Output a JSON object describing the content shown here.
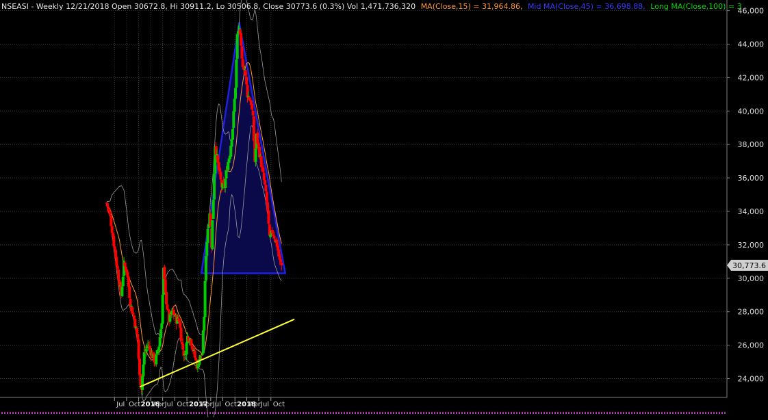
{
  "header": {
    "symbol_line": "NSEASI - Weekly 12/21/2018 Open 30672.8, Hi 30911.2, Lo 30506.8, Close 30773.6 (0.3%) Vol 1,471,736,320",
    "ma15": "MA(Close,15) = 31,964.86,",
    "mid_ma": "Mid MA(Close,45) = 36,698.88,",
    "long_ma": "Long MA(Close,100) = 3"
  },
  "colors": {
    "background": "#000000",
    "grid": "#404040",
    "up": "#00cc00",
    "down": "#ff0000",
    "ma15": "#ff9933",
    "bollinger": "#9a9a9a",
    "triangle_fill": "#0a0a4a",
    "triangle_stroke": "#2020e0",
    "trendline": "#ffff33",
    "header_default": "#e8e8e8",
    "header_ma15": "#ff9933",
    "header_mid": "#3a3aff",
    "header_long": "#00dd00",
    "price_tag": "#d0d0d0"
  },
  "chart_data": {
    "type": "candlestick",
    "title": "NSEASI - Weekly",
    "ylim": [
      23000,
      46500
    ],
    "yticks": [
      24000,
      26000,
      28000,
      30000,
      32000,
      34000,
      36000,
      38000,
      40000,
      42000,
      44000,
      46000
    ],
    "ytick_labels": [
      "24,000",
      "26,000",
      "28,000",
      "30,000",
      "32,000",
      "34,000",
      "36,000",
      "38,000",
      "40,000",
      "42,000",
      "44,000",
      "46,000"
    ],
    "xticks": [
      {
        "date": "2015-07-01",
        "label": "Jul",
        "major": false
      },
      {
        "date": "2015-10-01",
        "label": "Oct",
        "major": false
      },
      {
        "date": "2016-01-01",
        "label": "2016",
        "major": true
      },
      {
        "date": "2016-04-01",
        "label": "Apr",
        "major": false
      },
      {
        "date": "2016-07-01",
        "label": "Jul",
        "major": false
      },
      {
        "date": "2016-10-01",
        "label": "Oct",
        "major": false
      },
      {
        "date": "2017-01-01",
        "label": "2017",
        "major": true
      },
      {
        "date": "2017-04-01",
        "label": "Apr",
        "major": false
      },
      {
        "date": "2017-07-01",
        "label": "Jul",
        "major": false
      },
      {
        "date": "2017-10-01",
        "label": "Oct",
        "major": false
      },
      {
        "date": "2018-01-01",
        "label": "2018",
        "major": true
      },
      {
        "date": "2018-04-01",
        "label": "Apr",
        "major": false
      },
      {
        "date": "2018-07-01",
        "label": "Jul",
        "major": false
      },
      {
        "date": "2018-10-01",
        "label": "Oct",
        "major": false
      }
    ],
    "last_close": 30773.6,
    "last_close_label": "30,773.6",
    "last_date": "2018-12-21",
    "price_path": [
      [
        "2015-05-01",
        34500
      ],
      [
        "2015-05-29",
        33700
      ],
      [
        "2015-06-26",
        32100
      ],
      [
        "2015-07-24",
        30500
      ],
      [
        "2015-08-21",
        29000
      ],
      [
        "2015-09-11",
        30800
      ],
      [
        "2015-10-02",
        30500
      ],
      [
        "2015-10-30",
        28500
      ],
      [
        "2015-11-27",
        27600
      ],
      [
        "2015-12-25",
        26300
      ],
      [
        "2016-01-08",
        24100
      ],
      [
        "2016-01-22",
        23500
      ],
      [
        "2016-02-12",
        25500
      ],
      [
        "2016-03-11",
        26000
      ],
      [
        "2016-04-08",
        25500
      ],
      [
        "2016-05-06",
        25000
      ],
      [
        "2016-06-03",
        26000
      ],
      [
        "2016-06-24",
        27500
      ],
      [
        "2016-07-08",
        30500
      ],
      [
        "2016-07-22",
        29000
      ],
      [
        "2016-08-19",
        27500
      ],
      [
        "2016-09-16",
        28000
      ],
      [
        "2016-10-14",
        27500
      ],
      [
        "2016-11-04",
        27500
      ],
      [
        "2016-11-25",
        26000
      ],
      [
        "2016-12-16",
        25300
      ],
      [
        "2017-01-06",
        26500
      ],
      [
        "2017-01-27",
        26400
      ],
      [
        "2017-02-24",
        25500
      ],
      [
        "2017-03-17",
        24800
      ],
      [
        "2017-04-07",
        25200
      ],
      [
        "2017-04-28",
        25500
      ],
      [
        "2017-05-12",
        27800
      ],
      [
        "2017-05-26",
        31500
      ],
      [
        "2017-06-09",
        33000
      ],
      [
        "2017-06-23",
        34000
      ],
      [
        "2017-07-07",
        32000
      ],
      [
        "2017-07-21",
        34800
      ],
      [
        "2017-08-04",
        38000
      ],
      [
        "2017-08-25",
        36800
      ],
      [
        "2017-09-22",
        35500
      ],
      [
        "2017-10-13",
        35500
      ],
      [
        "2017-11-03",
        36700
      ],
      [
        "2017-11-24",
        37500
      ],
      [
        "2017-12-15",
        39000
      ],
      [
        "2018-01-05",
        41500
      ],
      [
        "2018-01-19",
        44500
      ],
      [
        "2018-02-02",
        45000
      ],
      [
        "2018-02-23",
        43000
      ],
      [
        "2018-03-16",
        42500
      ],
      [
        "2018-04-06",
        41000
      ],
      [
        "2018-05-04",
        40500
      ],
      [
        "2018-05-18",
        39500
      ],
      [
        "2018-06-01",
        37000
      ],
      [
        "2018-06-15",
        38500
      ],
      [
        "2018-06-29",
        37800
      ],
      [
        "2018-07-27",
        36500
      ],
      [
        "2018-08-17",
        35500
      ],
      [
        "2018-09-07",
        34000
      ],
      [
        "2018-09-21",
        32300
      ],
      [
        "2018-10-12",
        32800
      ],
      [
        "2018-10-26",
        32500
      ],
      [
        "2018-11-16",
        32000
      ],
      [
        "2018-12-07",
        31000
      ],
      [
        "2018-12-21",
        30773.6
      ]
    ],
    "triangle": [
      [
        "2017-04-21",
        30300
      ],
      [
        "2018-02-02",
        45300
      ],
      [
        "2019-01-18",
        30300
      ]
    ],
    "trendline": [
      [
        "2016-01-08",
        23500
      ],
      [
        "2019-03-29",
        27550
      ]
    ]
  }
}
